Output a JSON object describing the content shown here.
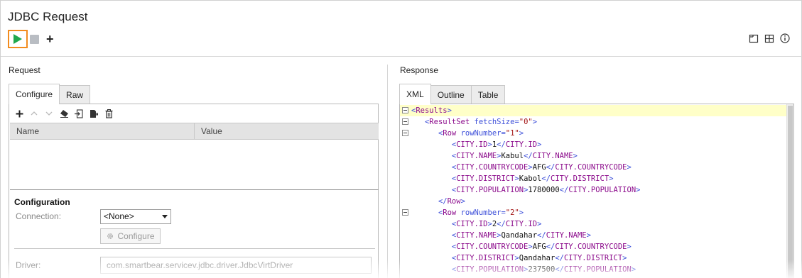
{
  "window": {
    "title": "JDBC Request"
  },
  "toolbar": {
    "run_icon": "play-icon",
    "stop_icon": "stop-icon",
    "add_icon": "plus-icon",
    "right_icons": [
      "layout-single-icon",
      "layout-grid-icon",
      "info-icon"
    ],
    "accent_color": "#f28c1e",
    "run_color": "#1fa84d"
  },
  "request": {
    "label": "Request",
    "tabs": [
      {
        "label": "Configure",
        "active": true
      },
      {
        "label": "Raw",
        "active": false
      }
    ],
    "grid": {
      "columns": [
        "Name",
        "Value"
      ],
      "rows": []
    },
    "configuration": {
      "title": "Configuration",
      "connection_label": "Connection:",
      "connection_value": "<None>",
      "configure_button": "Configure",
      "driver_label": "Driver:",
      "driver_value": "com.smartbear.servicev.jdbc.driver.JdbcVirtDriver"
    }
  },
  "response": {
    "label": "Response",
    "tabs": [
      {
        "label": "XML",
        "active": true
      },
      {
        "label": "Outline",
        "active": false
      },
      {
        "label": "Table",
        "active": false
      }
    ],
    "xml_lines": [
      "<Results>",
      "  <ResultSet fetchSize=\"0\">",
      "    <Row rowNumber=\"1\">",
      "      <CITY.ID>1</CITY.ID>",
      "      <CITY.NAME>Kabul</CITY.NAME>",
      "      <CITY.COUNTRYCODE>AFG</CITY.COUNTRYCODE>",
      "      <CITY.DISTRICT>Kabol</CITY.DISTRICT>",
      "      <CITY.POPULATION>1780000</CITY.POPULATION>",
      "    </Row>",
      "    <Row rowNumber=\"2\">",
      "      <CITY.ID>2</CITY.ID>",
      "      <CITY.NAME>Qandahar</CITY.NAME>",
      "      <CITY.COUNTRYCODE>AFG</CITY.COUNTRYCODE>",
      "      <CITY.DISTRICT>Qandahar</CITY.DISTRICT>",
      "      <CITY.POPULATION>237500</CITY.POPULATION>"
    ]
  }
}
